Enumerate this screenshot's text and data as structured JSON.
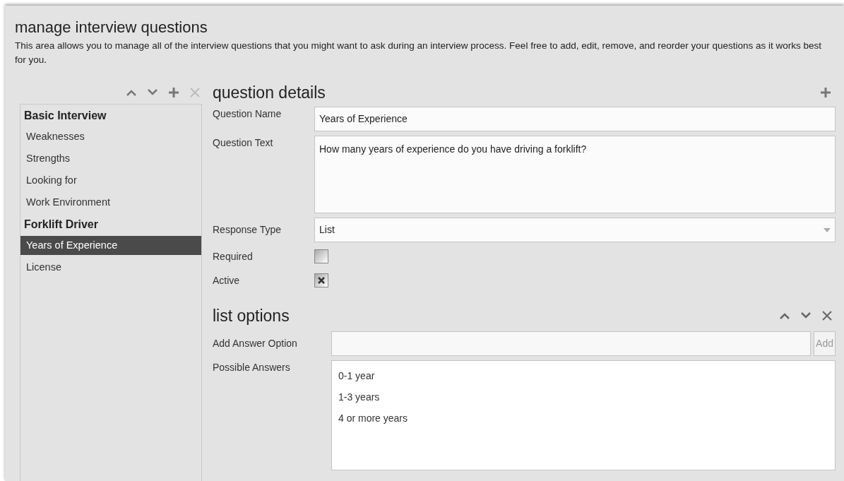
{
  "header": {
    "title": "manage interview questions",
    "description": "This area allows you to manage all of the interview questions that you might want to ask during an interview process. Feel free to add, edit, remove, and reorder your questions as it works best for you."
  },
  "question_list": {
    "groups": [
      {
        "name": "Basic Interview",
        "children": [
          {
            "label": "Weaknesses",
            "selected": false
          },
          {
            "label": "Strengths",
            "selected": false
          },
          {
            "label": "Looking for",
            "selected": false
          },
          {
            "label": "Work Environment",
            "selected": false
          }
        ]
      },
      {
        "name": "Forklift Driver",
        "children": [
          {
            "label": "Years of Experience",
            "selected": true
          },
          {
            "label": "License",
            "selected": false
          }
        ]
      }
    ]
  },
  "question_details": {
    "title": "question details",
    "fields": [
      {
        "kind": "text",
        "label": "Question Name",
        "value": "Years of Experience"
      },
      {
        "kind": "textarea",
        "label": "Question Text",
        "value": "How many years of experience do you have driving a forklift?"
      },
      {
        "kind": "select",
        "label": "Response Type",
        "value": "List"
      },
      {
        "kind": "checkbox",
        "label": "Required",
        "checked": false
      },
      {
        "kind": "checkbox",
        "label": "Active",
        "checked": true
      }
    ]
  },
  "list_options": {
    "title": "list options",
    "add_label": "Add Answer Option",
    "add_button": "Add",
    "answers_label": "Possible Answers",
    "answers": [
      "0-1 year",
      "1-3 years",
      "4 or more years"
    ]
  }
}
